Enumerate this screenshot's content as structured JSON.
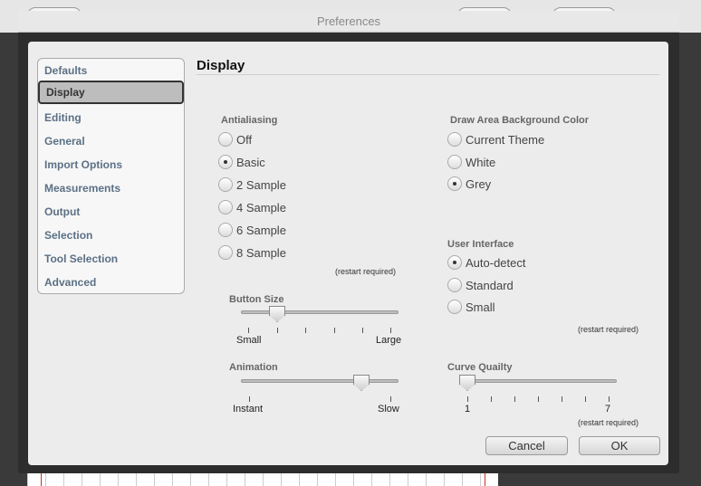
{
  "window": {
    "title": "Preferences"
  },
  "sidebar": {
    "items": [
      {
        "label": "Defaults"
      },
      {
        "label": "Display"
      },
      {
        "label": "Editing"
      },
      {
        "label": "General"
      },
      {
        "label": "Import Options"
      },
      {
        "label": "Measurements"
      },
      {
        "label": "Output"
      },
      {
        "label": "Selection"
      },
      {
        "label": "Tool Selection"
      },
      {
        "label": "Advanced"
      }
    ],
    "selected": "Display"
  },
  "main": {
    "title": "Display",
    "antialiasing": {
      "label": "Antialiasing",
      "options": [
        "Off",
        "Basic",
        "2 Sample",
        "4 Sample",
        "6 Sample",
        "8 Sample"
      ],
      "selected": "Basic",
      "note": "(restart required)"
    },
    "background_color": {
      "label": "Draw Area Background Color",
      "options": [
        "Current Theme",
        "White",
        "Grey"
      ],
      "selected": "Grey"
    },
    "user_interface": {
      "label": "User Interface",
      "options": [
        "Auto-detect",
        "Standard",
        "Small"
      ],
      "selected": "Auto-detect",
      "note": "(restart required)"
    },
    "button_size": {
      "label": "Button Size",
      "min_label": "Small",
      "max_label": "Large",
      "level": 0.2
    },
    "animation": {
      "label": "Animation",
      "min_label": "Instant",
      "max_label": "Slow",
      "level": 0.8
    },
    "curve_quality": {
      "label": "Curve Quailty",
      "min_label": "1",
      "max_label": "7",
      "value": 1,
      "note": "(restart required)"
    }
  },
  "buttons": {
    "cancel": "Cancel",
    "ok": "OK"
  }
}
